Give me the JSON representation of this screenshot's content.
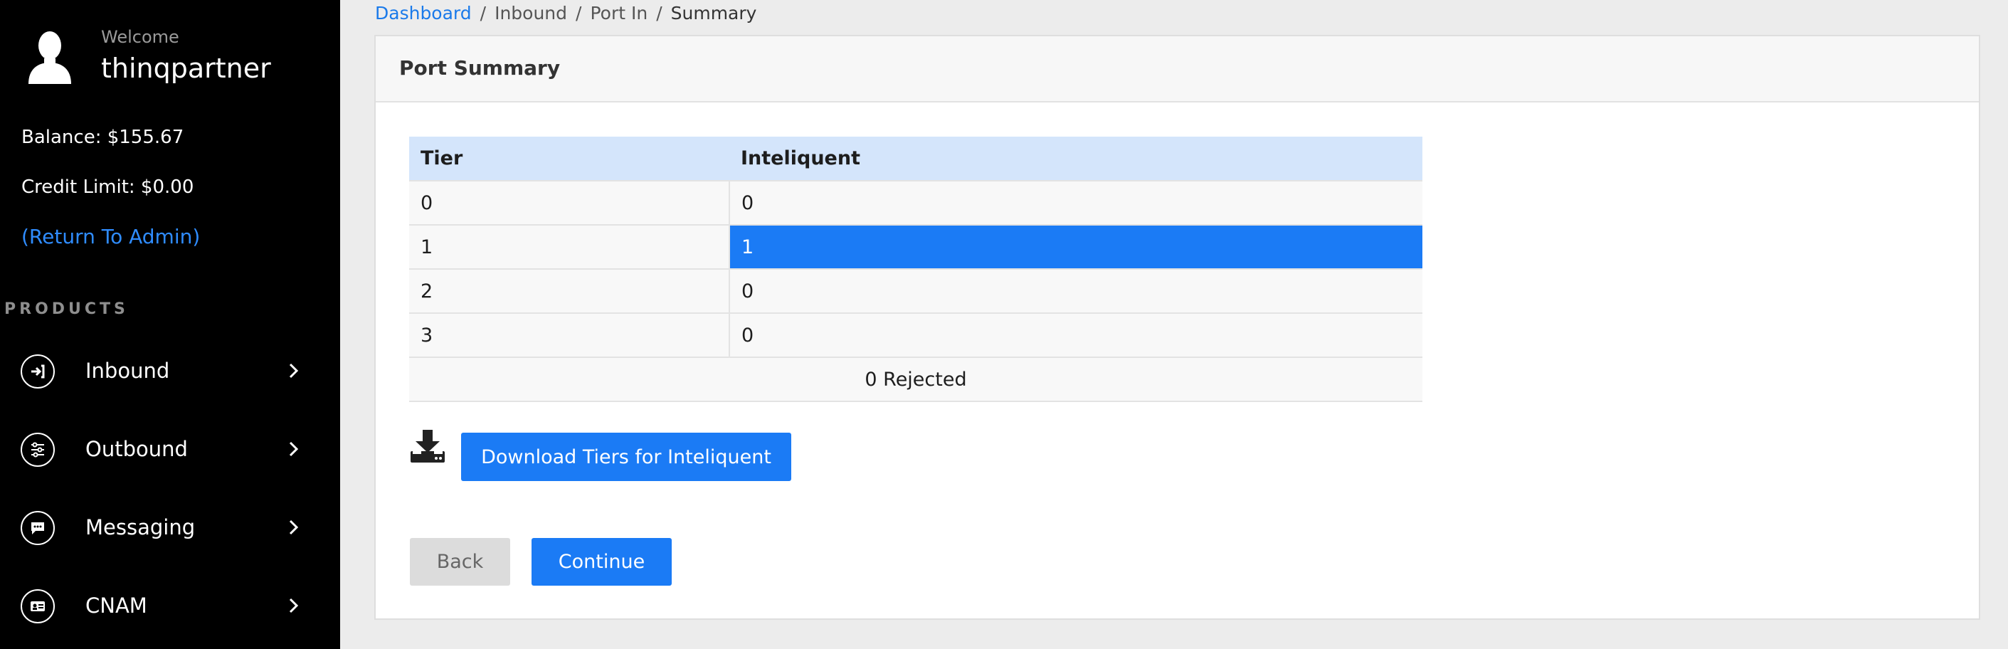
{
  "sidebar": {
    "welcome": "Welcome",
    "username": "thinqpartner",
    "balance": "Balance: $155.67",
    "credit_limit": "Credit Limit: $0.00",
    "return_admin": "(Return To Admin)",
    "products_heading": "PRODUCTS",
    "items": [
      {
        "label": "Inbound",
        "icon": "inbound-icon"
      },
      {
        "label": "Outbound",
        "icon": "outbound-icon"
      },
      {
        "label": "Messaging",
        "icon": "messaging-icon"
      },
      {
        "label": "CNAM",
        "icon": "cnam-icon"
      }
    ]
  },
  "breadcrumb": [
    "Dashboard",
    "Inbound",
    "Port In",
    "Summary"
  ],
  "card": {
    "title": "Port Summary"
  },
  "table": {
    "headers": [
      "Tier",
      "Inteliquent"
    ],
    "rows": [
      [
        "0",
        "0"
      ],
      [
        "1",
        "1"
      ],
      [
        "2",
        "0"
      ],
      [
        "3",
        "0"
      ]
    ],
    "footer": "0 Rejected"
  },
  "download_label": "Download Tiers for Inteliquent",
  "back_label": "Back",
  "continue_label": "Continue",
  "colors": {
    "accent": "#1b7bf5",
    "sidebar_bg": "#000000",
    "link": "#1a7aea",
    "table_header": "#d4e5fb"
  }
}
